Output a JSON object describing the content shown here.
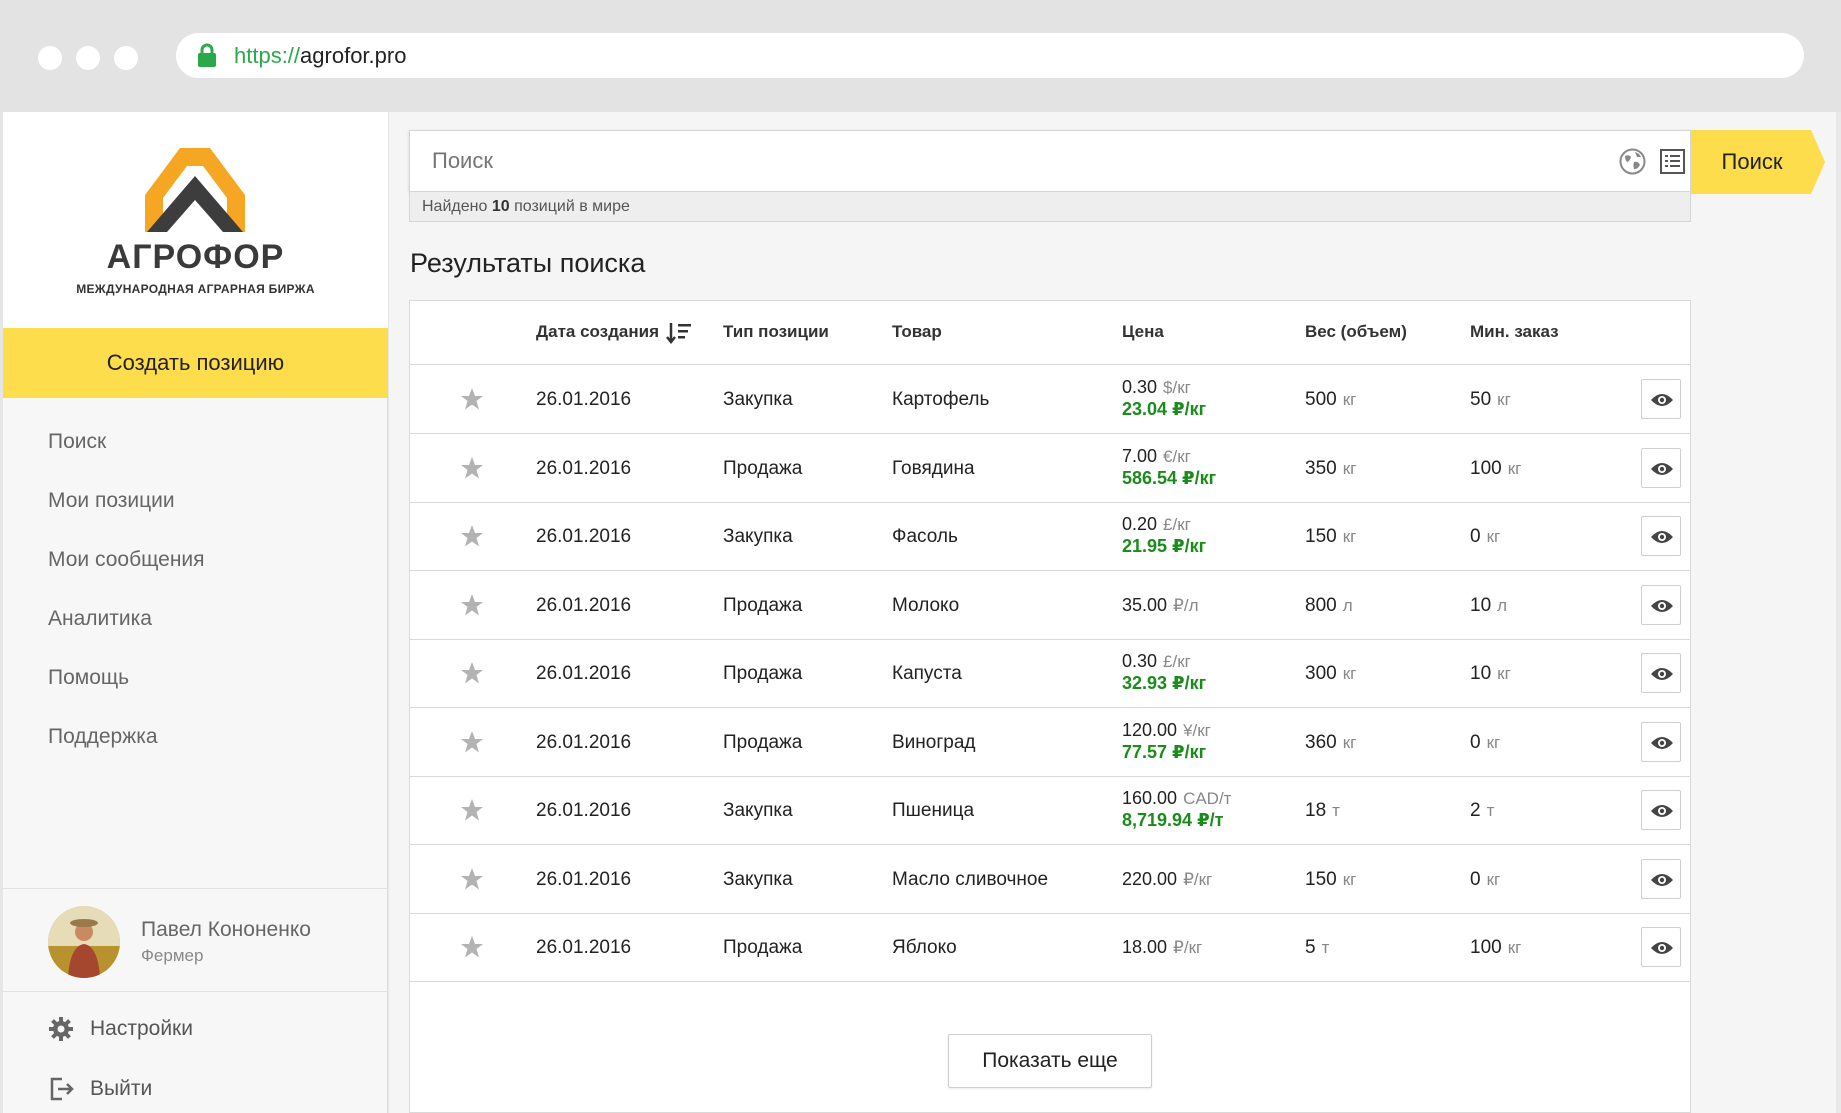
{
  "browser": {
    "url_protocol": "https://",
    "url_host": "agrofor.pro"
  },
  "logo": {
    "name": "АГРОФОР",
    "subtitle": "МЕЖДУНАРОДНАЯ АГРАРНАЯ БИРЖА"
  },
  "sidebar": {
    "create_label": "Создать позицию",
    "items": [
      {
        "label": "Поиск"
      },
      {
        "label": "Мои позиции"
      },
      {
        "label": "Мои сообщения"
      },
      {
        "label": "Аналитика"
      },
      {
        "label": "Помощь"
      },
      {
        "label": "Поддержка"
      }
    ],
    "user": {
      "name": "Павел Кононенко",
      "role": "Фермер"
    },
    "settings_label": "Настройки",
    "logout_label": "Выйти"
  },
  "search": {
    "placeholder": "Поиск",
    "button_label": "Поиск",
    "found_prefix": "Найдено",
    "found_count": "10",
    "found_suffix": "позиций в мире"
  },
  "results": {
    "title": "Результаты поиска",
    "columns": [
      "Дата создания",
      "Тип позиции",
      "Товар",
      "Цена",
      "Вес (объем)",
      "Мин. заказ"
    ],
    "rows": [
      {
        "date": "26.01.2016",
        "type": "Закупка",
        "product": "Картофель",
        "price": "0.30",
        "price_unit": "$/кг",
        "price_rub": "23.04 ₽/кг",
        "weight": "500",
        "weight_unit": "кг",
        "min": "50",
        "min_unit": "кг"
      },
      {
        "date": "26.01.2016",
        "type": "Продажа",
        "product": "Говядина",
        "price": "7.00",
        "price_unit": "€/кг",
        "price_rub": "586.54 ₽/кг",
        "weight": "350",
        "weight_unit": "кг",
        "min": "100",
        "min_unit": "кг"
      },
      {
        "date": "26.01.2016",
        "type": "Закупка",
        "product": "Фасоль",
        "price": "0.20",
        "price_unit": "£/кг",
        "price_rub": "21.95 ₽/кг",
        "weight": "150",
        "weight_unit": "кг",
        "min": "0",
        "min_unit": "кг"
      },
      {
        "date": "26.01.2016",
        "type": "Продажа",
        "product": "Молоко",
        "price": "35.00",
        "price_unit": "₽/л",
        "price_rub": "",
        "weight": "800",
        "weight_unit": "л",
        "min": "10",
        "min_unit": "л"
      },
      {
        "date": "26.01.2016",
        "type": "Продажа",
        "product": "Капуста",
        "price": "0.30",
        "price_unit": "£/кг",
        "price_rub": "32.93 ₽/кг",
        "weight": "300",
        "weight_unit": "кг",
        "min": "10",
        "min_unit": "кг"
      },
      {
        "date": "26.01.2016",
        "type": "Продажа",
        "product": "Виноград",
        "price": "120.00",
        "price_unit": "¥/кг",
        "price_rub": "77.57 ₽/кг",
        "weight": "360",
        "weight_unit": "кг",
        "min": "0",
        "min_unit": "кг"
      },
      {
        "date": "26.01.2016",
        "type": "Закупка",
        "product": "Пшеница",
        "price": "160.00",
        "price_unit": "CAD/т",
        "price_rub": "8,719.94 ₽/т",
        "weight": "18",
        "weight_unit": "т",
        "min": "2",
        "min_unit": "т"
      },
      {
        "date": "26.01.2016",
        "type": "Закупка",
        "product": "Масло сливочное",
        "price": "220.00",
        "price_unit": "₽/кг",
        "price_rub": "",
        "weight": "150",
        "weight_unit": "кг",
        "min": "0",
        "min_unit": "кг"
      },
      {
        "date": "26.01.2016",
        "type": "Продажа",
        "product": "Яблоко",
        "price": "18.00",
        "price_unit": "₽/кг",
        "price_rub": "",
        "weight": "5",
        "weight_unit": "т",
        "min": "100",
        "min_unit": "кг"
      }
    ],
    "show_more_label": "Показать еще"
  },
  "colors": {
    "accent_yellow": "#fddd4c",
    "rub_green": "#1b8c1b",
    "logo_orange": "#f5a623",
    "logo_dark": "#3d3d3d"
  }
}
